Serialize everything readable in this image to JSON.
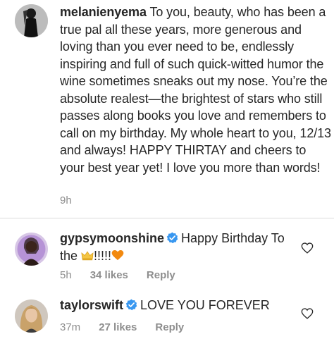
{
  "caption": {
    "username": "melanienyema",
    "text": "To you, beauty, who has been a true pal all these years, more generous and loving than you ever need to be, endlessly inspiring and full of such quick-witted humor the wine sometimes sneaks out my nose. You’re the absolute realest—the brightest of stars who still passes along books you love and remembers to call on my birthday. My whole heart to you, 12/13 and always! HAPPY THIRTAY and cheers to your best year yet! I love you more than words!",
    "time": "9h"
  },
  "comments": [
    {
      "username": "gypsymoonshine",
      "verified": true,
      "text_before": "Happy Birthday To the ",
      "icon_inline": "crown-emoji",
      "text_after": "!!!!!",
      "icon_end": "orange-heart-emoji",
      "time": "5h",
      "likes": "34 likes",
      "reply_label": "Reply"
    },
    {
      "username": "taylorswift",
      "verified": true,
      "text": "LOVE YOU FOREVER",
      "time": "37m",
      "likes": "27 likes",
      "reply_label": "Reply"
    }
  ],
  "icons": {
    "verified": "verified-badge-icon",
    "like": "heart-outline-icon"
  },
  "colors": {
    "text": "#262626",
    "meta": "#8e8e8e",
    "verified": "#3897f0",
    "divider": "#dbdbdb"
  }
}
